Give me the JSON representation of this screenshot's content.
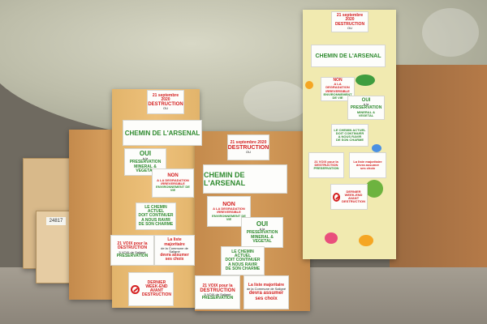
{
  "signs": {
    "date_text": "21 septembre 2020",
    "destruction": "DESTRUCTION",
    "ou": "OU",
    "chemin": "CHEMIN DE L'ARSENAL",
    "oui": "OUI",
    "a_la": "à la",
    "preservation": "PRESERVATION",
    "patrimoine": "du petit patrimoine",
    "mineral": "MINERAL & VEGETAL",
    "non": "NON",
    "degradation": "A LA DEGRADATION IRREVERSIBLE",
    "environnement": "ENVIRONNEMENT DE VIE",
    "actuel_1": "LE CHEMIN ACTUEL",
    "actuel_2": "DOIT CONTINUER",
    "actuel_3": "A NOUS RAVIR",
    "actuel_4": "DE SON CHARME",
    "voix": "21 VOIX pour la",
    "voir": "5 VOIX de Saligné",
    "liste_1": "La liste majoritaire",
    "liste_2": "de la Commune de Saligné",
    "liste_3": "devra assumer",
    "liste_4": "ses choix",
    "dernier_1": "DERNIER",
    "dernier_2": "WEEK-END",
    "dernier_3": "AVANT",
    "dernier_4": "DESTRUCTION",
    "box_label": "24817"
  },
  "colors": {
    "green_text": "#2e8a2e",
    "red_text": "#d42020",
    "yellow_board": "#f1eab0",
    "plywood": "#d39b5a"
  }
}
